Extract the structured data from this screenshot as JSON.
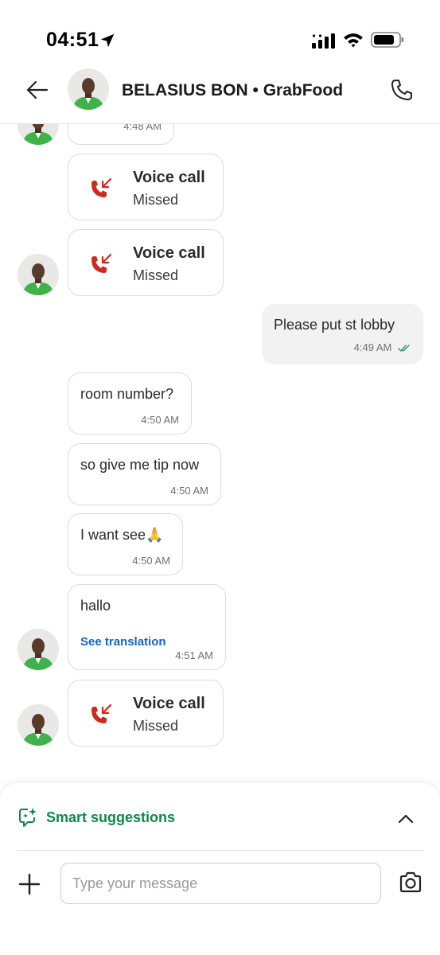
{
  "status_bar": {
    "time": "04:51",
    "icons": [
      "location-arrow-icon",
      "cellular-signal-icon",
      "wifi-icon",
      "battery-icon"
    ]
  },
  "header": {
    "title": "BELASIUS BON • GrabFood",
    "icons": [
      "back-arrow-icon",
      "phone-icon"
    ]
  },
  "messages": [
    {
      "type": "partial",
      "time": "4:48 AM"
    },
    {
      "type": "call",
      "title": "Voice call",
      "status": "Missed"
    },
    {
      "type": "call",
      "title": "Voice call",
      "status": "Missed"
    },
    {
      "type": "outgoing",
      "text": "Please put st lobby",
      "time": "4:49 AM",
      "read": true
    },
    {
      "type": "incoming",
      "text": "room number?",
      "time": "4:50 AM"
    },
    {
      "type": "incoming",
      "text": "so give me tip now",
      "time": "4:50 AM"
    },
    {
      "type": "incoming",
      "text": "I want see🙏",
      "time": "4:50 AM"
    },
    {
      "type": "incoming",
      "text": "hallo",
      "action": "See translation",
      "time": "4:51 AM"
    },
    {
      "type": "call",
      "title": "Voice call",
      "status": "Missed"
    }
  ],
  "composer": {
    "smart_suggestions_label": "Smart suggestions",
    "input_placeholder": "Type your message",
    "input_value": ""
  },
  "colors": {
    "accent_green": "#0b8a4a",
    "missed_call_red": "#d0291d",
    "link_blue": "#1565c0",
    "read_tick_green": "#1aa260",
    "outgoing_bubble": "#f2f2f2"
  }
}
